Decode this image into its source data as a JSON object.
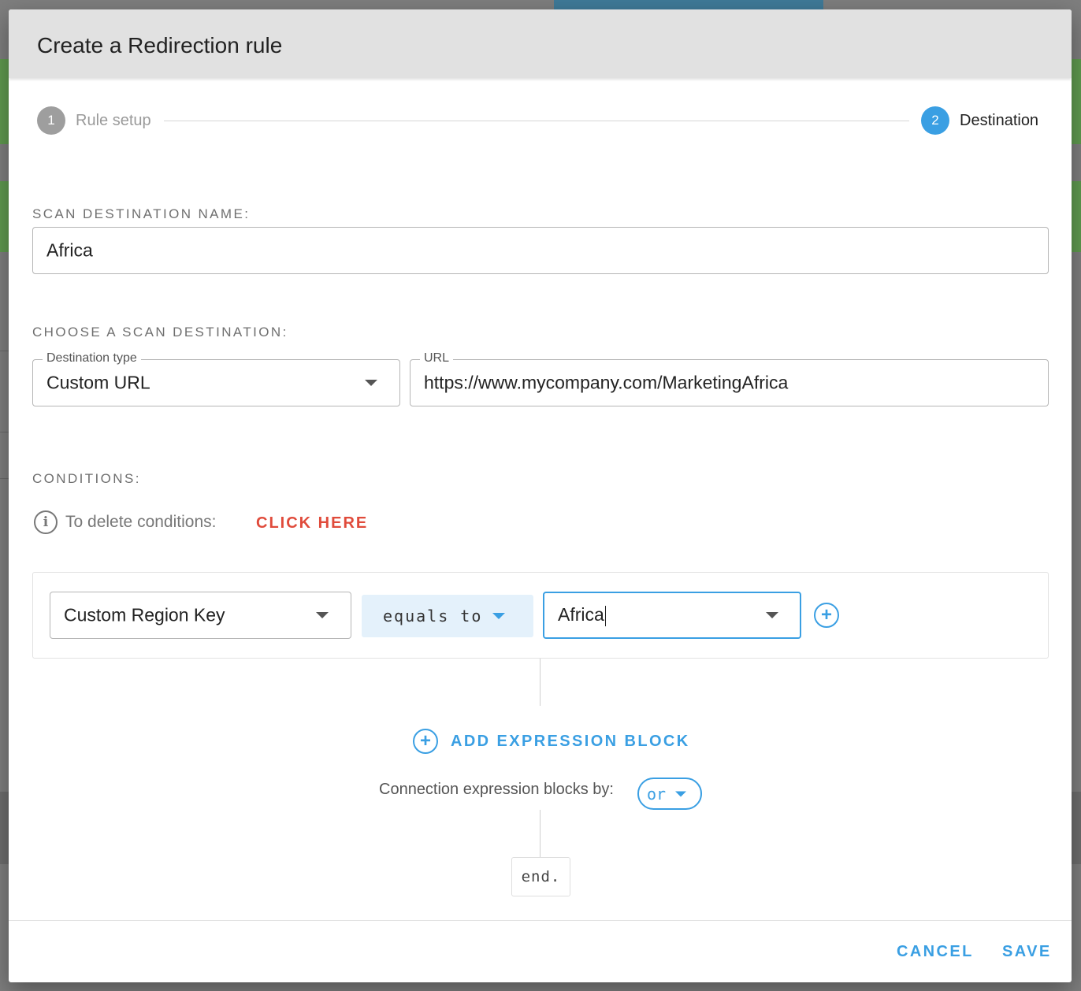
{
  "dialog": {
    "title": "Create a Redirection rule"
  },
  "stepper": {
    "steps": [
      {
        "number": "1",
        "label": "Rule setup"
      },
      {
        "number": "2",
        "label": "Destination"
      }
    ],
    "active_step": 2
  },
  "scan_destination_name": {
    "label": "SCAN DESTINATION NAME:",
    "value": "Africa"
  },
  "scan_destination": {
    "label": "CHOOSE A SCAN DESTINATION:",
    "destination_type": {
      "label": "Destination type",
      "value": "Custom URL"
    },
    "url": {
      "label": "URL",
      "value": "https://www.mycompany.com/MarketingAfrica"
    }
  },
  "conditions": {
    "label": "CONDITIONS:",
    "delete_hint": "To delete conditions:",
    "delete_link": "CLICK HERE",
    "expression": {
      "key": "Custom Region Key",
      "operator": "equals to",
      "value": "Africa"
    },
    "add_block_label": "ADD EXPRESSION BLOCK",
    "connect_label": "Connection expression blocks by:",
    "connector": "or",
    "end_label": "end."
  },
  "footer": {
    "cancel_label": "CANCEL",
    "save_label": "SAVE"
  },
  "colors": {
    "accent": "#3a9fe3",
    "danger": "#e04b3b",
    "header_bg": "#e1e1e1"
  }
}
